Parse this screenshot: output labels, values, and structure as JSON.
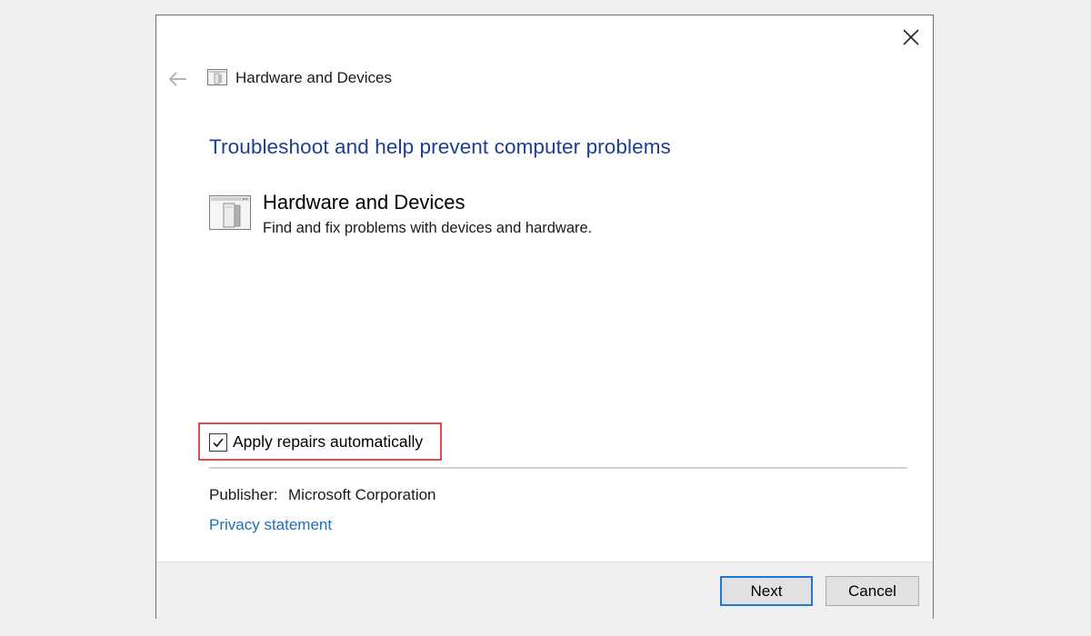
{
  "window": {
    "close_icon": "close-icon",
    "back_icon": "back-arrow-icon"
  },
  "header": {
    "title": "Hardware and Devices",
    "icon": "hardware-devices-icon"
  },
  "main": {
    "heading": "Troubleshoot and help prevent computer problems",
    "troubleshooter": {
      "title": "Hardware and Devices",
      "description": "Find and fix problems with devices and hardware.",
      "icon": "hardware-devices-icon"
    },
    "apply_repairs": {
      "label": "Apply repairs automatically",
      "checked": true
    },
    "publisher": {
      "label": "Publisher:",
      "value": "Microsoft Corporation"
    },
    "privacy_link": "Privacy statement"
  },
  "footer": {
    "next_label": "Next",
    "cancel_label": "Cancel"
  },
  "colors": {
    "heading_blue": "#1c3f94",
    "link_blue": "#1e6eb8",
    "highlight_red": "#dd4b4b",
    "default_button_border": "#1e78d4"
  }
}
